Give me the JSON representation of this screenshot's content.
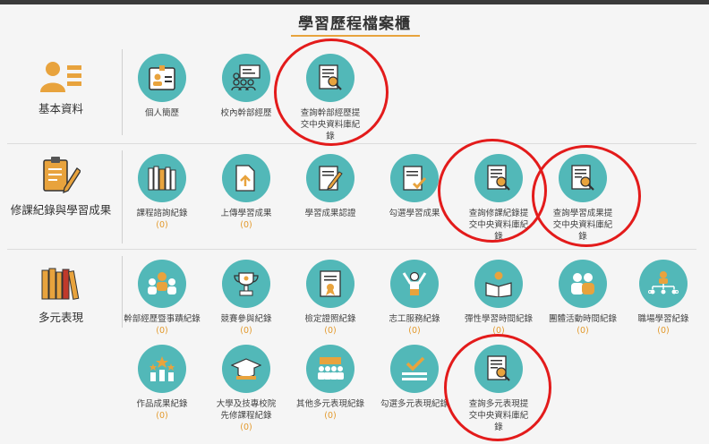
{
  "page": {
    "title": "學習歷程檔案櫃"
  },
  "sections": {
    "basic": {
      "label": "基本資料",
      "items": [
        {
          "label": "個人簡歷",
          "count": ""
        },
        {
          "label": "校內幹部經歷",
          "count": ""
        },
        {
          "label": "查詢幹部經歷提交中央資料庫紀錄",
          "count": ""
        }
      ]
    },
    "courses": {
      "label": "修課紀錄與學習成果",
      "items": [
        {
          "label": "課程諮詢紀錄",
          "count": "(0)"
        },
        {
          "label": "上傳學習成果",
          "count": "(0)"
        },
        {
          "label": "學習成果認證",
          "count": ""
        },
        {
          "label": "勾選學習成果",
          "count": ""
        },
        {
          "label": "查詢修課紀錄提交中央資料庫紀錄",
          "count": ""
        },
        {
          "label": "查詢學習成果提交中央資料庫紀錄",
          "count": ""
        }
      ]
    },
    "performance": {
      "label": "多元表現",
      "items": [
        {
          "label": "幹部經歷暨事蹟紀錄",
          "count": "(0)"
        },
        {
          "label": "競賽參與紀錄",
          "count": "(0)"
        },
        {
          "label": "檢定證照紀錄",
          "count": "(0)"
        },
        {
          "label": "志工服務紀錄",
          "count": "(0)"
        },
        {
          "label": "彈性學習時間紀錄",
          "count": "(0)"
        },
        {
          "label": "團體活動時間紀錄",
          "count": "(0)"
        },
        {
          "label": "職場學習紀錄",
          "count": "(0)"
        },
        {
          "label": "作品成果紀錄",
          "count": "(0)"
        },
        {
          "label": "大學及技專校院先修課程紀錄",
          "count": "(0)"
        },
        {
          "label": "其他多元表現紀錄",
          "count": "(0)"
        },
        {
          "label": "勾選多元表現紀錄",
          "count": ""
        },
        {
          "label": "查詢多元表現提交中央資料庫紀錄",
          "count": ""
        }
      ]
    }
  },
  "colors": {
    "teal": "#52b8b8",
    "orange": "#e8a33d",
    "highlight_ring": "#e31b1b"
  }
}
